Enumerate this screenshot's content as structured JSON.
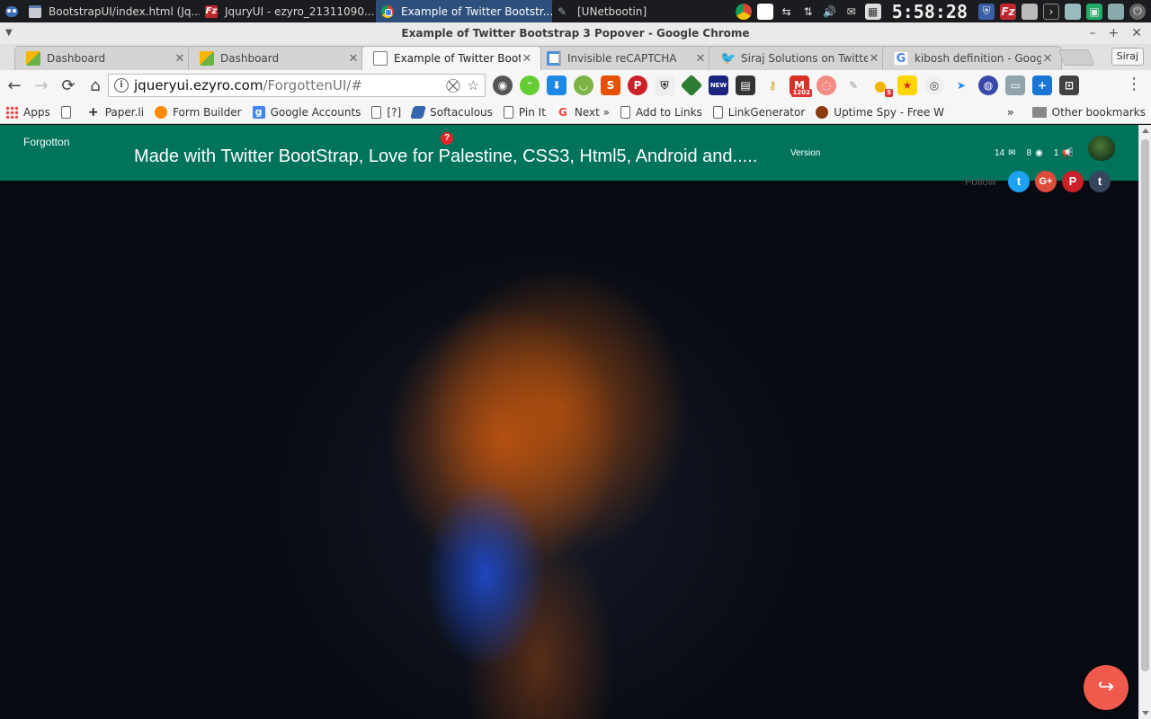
{
  "taskbar": {
    "tasks": [
      {
        "label": "BootstrapUI/index.html (Jq...",
        "icon": "window-icon"
      },
      {
        "label": "JquryUI - ezyro_21311090...",
        "icon": "filezilla-icon"
      },
      {
        "label": "Example of Twitter Bootstr...",
        "icon": "chrome-icon"
      },
      {
        "label": "[UNetbootin]",
        "icon": "usb-icon"
      }
    ],
    "clock": "5:58:28"
  },
  "window": {
    "title": "Example of Twitter Bootstrap 3 Popover - Google Chrome",
    "controls": {
      "minimize": "–",
      "maximize": "+",
      "close": "✕"
    }
  },
  "tabs": [
    {
      "label": "Dashboard",
      "icon": "dashboard-icon",
      "active": false
    },
    {
      "label": "Dashboard",
      "icon": "dashboard-icon",
      "active": false
    },
    {
      "label": "Example of Twitter Boot",
      "icon": "page-icon",
      "active": true
    },
    {
      "label": "Invisible reCAPTCHA",
      "icon": "recaptcha-icon",
      "active": false
    },
    {
      "label": "Siraj Solutions on Twitte",
      "icon": "twitter-icon",
      "active": false
    },
    {
      "label": "kibosh definition - Goog",
      "icon": "google-icon",
      "active": false
    }
  ],
  "profile_name": "Siraj",
  "omnibox": {
    "host": "jqueryui.ezyro.com",
    "path": "/ForgottenUI/#"
  },
  "extensions": {
    "gmail_badge": "1202",
    "bulb_badge": "5"
  },
  "bookmarks": [
    {
      "label": "Apps",
      "icon": "apps-icon"
    },
    {
      "label": "",
      "icon": "page-icon"
    },
    {
      "label": "Paper.li",
      "icon": "plus-icon"
    },
    {
      "label": "Form Builder",
      "icon": "form-builder-icon"
    },
    {
      "label": "Google Accounts",
      "icon": "google-icon"
    },
    {
      "label": "[?]",
      "icon": "page-icon"
    },
    {
      "label": "Softaculous",
      "icon": "softaculous-icon"
    },
    {
      "label": "Pin It",
      "icon": "page-icon"
    },
    {
      "label": "Next »",
      "icon": "google-icon"
    },
    {
      "label": "Add to Links",
      "icon": "page-icon"
    },
    {
      "label": "LinkGenerator",
      "icon": "page-icon"
    },
    {
      "label": "Uptime Spy - Free W",
      "icon": "uptime-icon"
    }
  ],
  "bookmarks_more": "»",
  "other_bookmarks": "Other bookmarks",
  "page": {
    "brand": "Forgotton",
    "headline": "Made with Twitter BootStrap, Love for Palestine, CSS3, Html5, Android and.....",
    "help_icon": "?",
    "version_label": "Version",
    "stats": {
      "messages": "14",
      "views": "8",
      "announcements": "1"
    },
    "follow_label": "Follow",
    "social": {
      "twitter": "t",
      "googleplus": "G+",
      "pinterest": "P",
      "tumblr": "t"
    },
    "share_icon": "↪"
  },
  "colors": {
    "navbar": "#00735b",
    "fab": "#ef5a4c",
    "twitter": "#1da1f2"
  }
}
